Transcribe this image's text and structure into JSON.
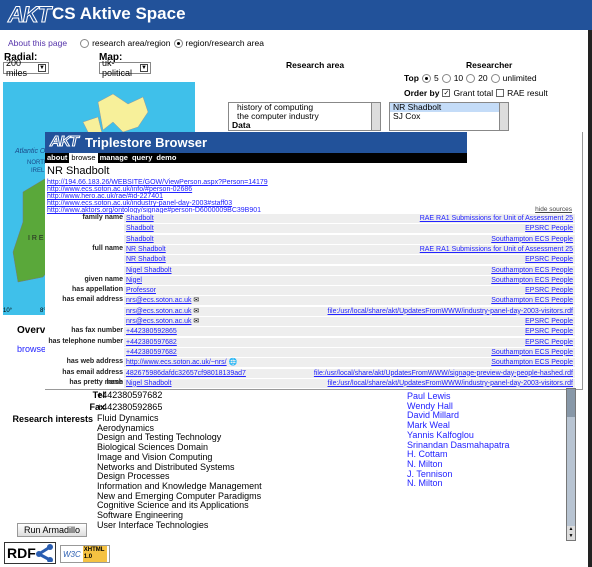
{
  "header": {
    "logo": "AKT",
    "title": "CS Aktive Space"
  },
  "top": {
    "about": "About this page",
    "modes": [
      {
        "label": "research area/region",
        "selected": false
      },
      {
        "label": "region/research area",
        "selected": true
      }
    ]
  },
  "radial": {
    "label": "Radial:",
    "value": "200 miles"
  },
  "map": {
    "label": "Map:",
    "value": "uk-political",
    "map_labels": [
      "Atlantic O",
      "NORTH",
      "IREL",
      "I R E",
      "10°",
      "8°"
    ]
  },
  "research_area": {
    "heading": "Research area",
    "items": [
      "history of computing",
      "the computer industry",
      "Data"
    ]
  },
  "researcher": {
    "heading": "Researcher",
    "top_label": "Top",
    "top_options": [
      {
        "label": "5",
        "selected": true
      },
      {
        "label": "10",
        "selected": false
      },
      {
        "label": "20",
        "selected": false
      },
      {
        "label": "unlimited",
        "selected": false
      }
    ],
    "order_label": "Order by",
    "order_options": [
      {
        "label": "Grant total",
        "checked": true
      },
      {
        "label": "RAE result",
        "checked": false
      }
    ],
    "items": [
      "NR Shadbolt",
      "SJ Cox"
    ]
  },
  "overview": {
    "heading": "Overvi",
    "link": "browse"
  },
  "triplestore": {
    "logo": "AKT",
    "title": "Triplestore Browser",
    "nav": [
      "about",
      "browse",
      "manage",
      "query",
      "demo"
    ],
    "active_nav": "browse",
    "person": "NR Shadbolt",
    "urls": [
      "http://194.66.183.26/WEBSITE/GOW/ViewPerson.aspx?Person=14179",
      "http://www.ecs.soton.ac.uk/info/#person-02686",
      "http://www.hero.ac.uk/rae/#id-227401",
      "http://www.ecs.soton.ac.uk/industry-panel-day-2003#staff03",
      "http://www.aktors.org/ontology/signage#person-D6000009BC39B901"
    ],
    "hide_sources": "hide sources",
    "rows": [
      {
        "label": "family name",
        "value": "Shadbolt",
        "source": "RAE RA1 Submissions for Unit of Assessment 25"
      },
      {
        "label": "",
        "value": "Shadbolt",
        "source": "EPSRC People"
      },
      {
        "label": "",
        "value": "Shadbolt",
        "source": "Southampton ECS People"
      },
      {
        "label": "full name",
        "value": "NR Shadbolt",
        "source": "RAE RA1 Submissions for Unit of Assessment 25"
      },
      {
        "label": "",
        "value": "NR Shadbolt",
        "source": "EPSRC People"
      },
      {
        "label": "",
        "value": "Nigel Shadbolt",
        "source": "Southampton ECS People"
      },
      {
        "label": "given name",
        "value": "Nigel",
        "source": "Southampton ECS People"
      },
      {
        "label": "has appellation",
        "value": "Professor",
        "source": "EPSRC People"
      },
      {
        "label": "has email address",
        "value": "nrs@ecs.soton.ac.uk",
        "source": "Southampton ECS People",
        "icon": "mail-icon"
      },
      {
        "label": "",
        "value": "nrs@ecs.soton.ac.uk",
        "source": "file:/usr/local/share/akt/UpdatesFromWWW/industry-panel-day-2003-visitors.rdf",
        "icon": "mail-icon"
      },
      {
        "label": "",
        "value": "nrs@ecs.soton.ac.uk",
        "source": "EPSRC People",
        "icon": "mail-icon"
      },
      {
        "label": "has fax number",
        "value": "+442380592865",
        "source": "EPSRC People"
      },
      {
        "label": "has telephone number",
        "value": "+442380597682",
        "source": "EPSRC People"
      },
      {
        "label": "",
        "value": "+442380597682",
        "source": "Southampton ECS People"
      },
      {
        "label": "has web address",
        "value": "http://www.ecs.soton.ac.uk/~nrs/",
        "source": "Southampton ECS People",
        "icon": "web-icon"
      },
      {
        "label": "has email address hash",
        "value": "482675986dafdc32657cf98018139ad7",
        "source": "file:/usr/local/share/akt/UpdatesFromWWW/signage-preview-day-people-hashed.rdf"
      },
      {
        "label": "has pretty name",
        "value": "Nigel Shadbolt",
        "source": "file:/usr/local/share/akt/UpdatesFromWWW/industry-panel-day-2003-visitors.rdf"
      }
    ]
  },
  "details": {
    "tel_label": "Tel",
    "tel": "+442380597682",
    "fax_label": "Fax",
    "fax": "+442380592865",
    "ri_label": "Research interests",
    "interests": [
      "Fluid Dynamics",
      "Aerodynamics",
      "Design and Testing Technology",
      "Biological Sciences Domain",
      "Image and Vision Computing",
      "Networks and Distributed Systems",
      "Design Processes",
      "Information and Knowledge Management",
      "New and Emerging Computer Paradigms",
      "Cognitive Science and its Applications",
      "Software Engineering",
      "User Interface Technologies"
    ]
  },
  "people": [
    "Paul Lewis",
    "Wendy Hall",
    "David Millard",
    "Mark Weal",
    "Yannis Kalfoglou",
    "Srinandan Dasmahapatra",
    "H. Cottam",
    "N. Milton",
    "J. Tennison",
    "N. Milton"
  ],
  "run_button": "Run Armadillo",
  "badges": {
    "rdf": "RDF",
    "w3c": "W3C",
    "xhtml": "XHTML 1.0"
  },
  "colors": {
    "brand": "#22529a",
    "link": "#2222ff",
    "sea": "#3fc0ea"
  }
}
